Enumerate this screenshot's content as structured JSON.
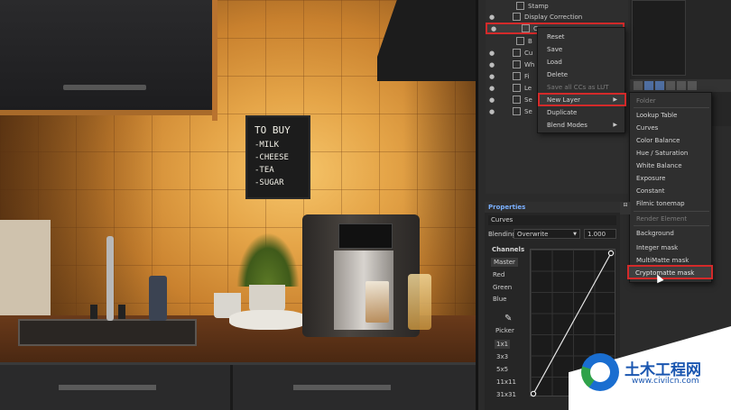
{
  "viewport": {
    "chalkboard": [
      "TO BUY",
      "-MILK",
      "-CHEESE",
      "-TEA",
      "-SUGAR"
    ]
  },
  "layers": [
    {
      "label": "Stamp"
    },
    {
      "label": "Display Correction"
    },
    {
      "label": "Curves"
    },
    {
      "label": "B"
    },
    {
      "label": "Cu"
    },
    {
      "label": "Wh"
    },
    {
      "label": "Fi"
    },
    {
      "label": "Le"
    },
    {
      "label": "Se"
    },
    {
      "label": "Se"
    }
  ],
  "context_menu": {
    "items": [
      "Reset",
      "Save",
      "Load",
      "Delete",
      "Save all CCs as LUT",
      "New Layer",
      "Duplicate",
      "Blend Modes"
    ],
    "disabled": [
      "Save all CCs as LUT"
    ]
  },
  "submenu": {
    "group1_header": "Folder",
    "items1": [
      "Lookup Table",
      "Curves",
      "Color Balance",
      "Hue / Saturation",
      "White Balance",
      "Exposure",
      "Constant",
      "Filmic tonemap"
    ],
    "group2_header": "Render Element",
    "items2": [
      "Background",
      "Integer mask",
      "MultiMatte mask",
      "Cryptomatte mask"
    ]
  },
  "properties": {
    "title": "Properties",
    "name": "Curves",
    "blending_label": "Blending",
    "blending_mode": "Overwrite",
    "blending_value": "1.000",
    "channels_title": "Channels",
    "channels": [
      "Master",
      "Red",
      "Green",
      "Blue"
    ],
    "picker_label": "Picker",
    "sizes": [
      "1x1",
      "3x3",
      "5x5",
      "11x11",
      "31x31"
    ]
  },
  "watermark": {
    "title": "土木工程网",
    "url": "www.civilcn.com"
  },
  "colors": {
    "highlight_red": "#d42a2a",
    "accent_blue": "#7bb0ff"
  }
}
